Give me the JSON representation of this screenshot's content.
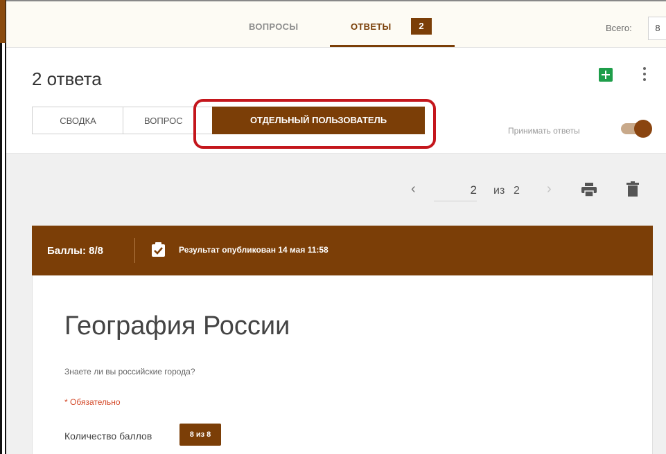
{
  "colors": {
    "accent": "#7b3e07",
    "highlight": "#c4161c",
    "required": "#d44a2a",
    "sheets": "#1e9e4a"
  },
  "tabs": {
    "questions_label": "ВОПРОСЫ",
    "answers_label": "ОТВЕТЫ",
    "answers_count": "2",
    "total_label": "Всего:",
    "total_value": "8"
  },
  "header": {
    "title": "2 ответа",
    "segments": {
      "summary": "СВОДКА",
      "question": "ВОПРОС",
      "individual": "ОТДЕЛЬНЫЙ ПОЛЬЗОВАТЕЛЬ"
    },
    "accept_label": "Принимать ответы",
    "accept_enabled": true,
    "icons": [
      "sheets-icon",
      "more-vert-icon"
    ]
  },
  "pagination": {
    "current": "2",
    "of_label": "из",
    "total": "2",
    "icons": [
      "chevron-left-icon",
      "chevron-right-icon",
      "print-icon",
      "trash-icon"
    ]
  },
  "card": {
    "score": "Баллы: 8/8",
    "published": "Результат опубликован 14 мая 11:58",
    "title": "География России",
    "description": "Знаете ли вы российские города?",
    "required": "* Обязательно",
    "score_label": "Количество баллов",
    "score_badge": "8 из 8"
  }
}
